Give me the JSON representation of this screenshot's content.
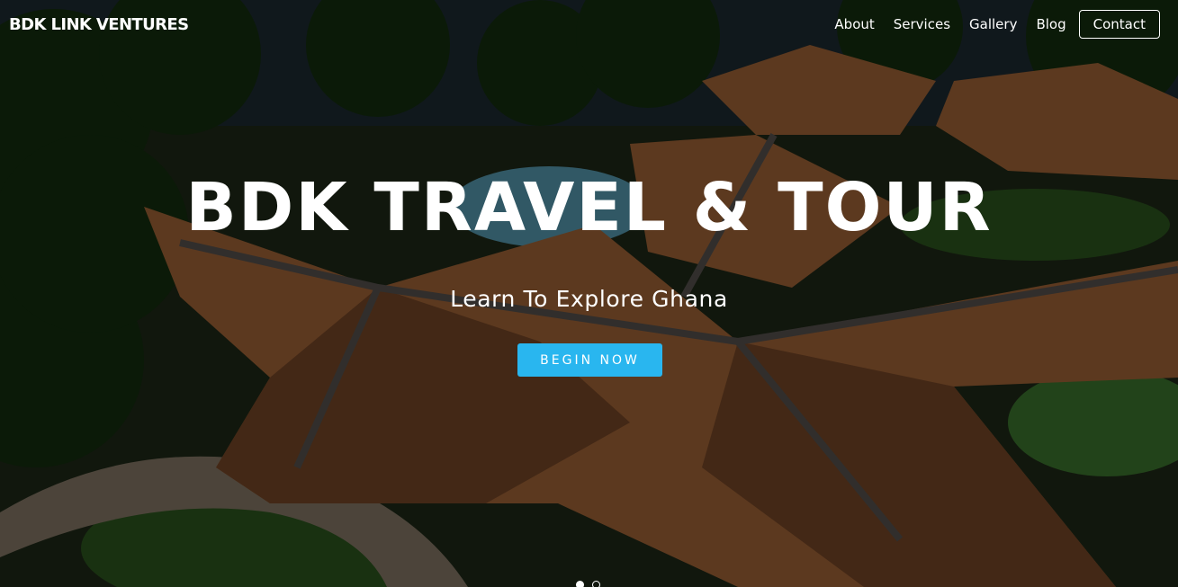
{
  "brand": {
    "name": "BDK LINK VENTURES"
  },
  "nav": {
    "items": [
      {
        "label": "About"
      },
      {
        "label": "Services"
      },
      {
        "label": "Gallery"
      },
      {
        "label": "Blog"
      }
    ],
    "contact_label": "Contact"
  },
  "hero": {
    "title": "BDK TRAVEL & TOUR",
    "subtitle": "Learn To Explore Ghana",
    "cta_label": "BEGIN NOW",
    "background_description_icon": "aerial-resort-photo",
    "slides": {
      "count": 2,
      "active_index": 0
    }
  },
  "colors": {
    "accent": "#29b6ef",
    "text": "#ffffff",
    "overlay": "#000000"
  }
}
